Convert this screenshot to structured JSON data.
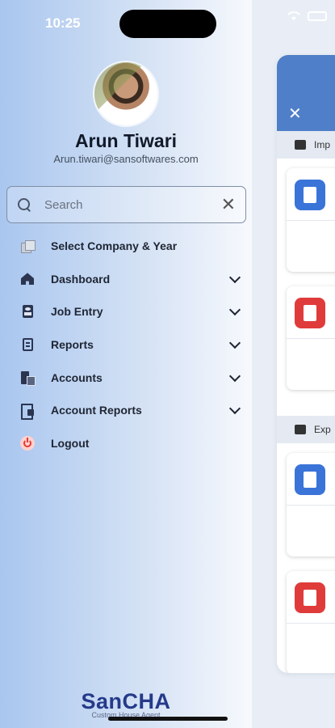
{
  "status_bar": {
    "time": "10:25"
  },
  "user": {
    "name": "Arun Tiwari",
    "email": "Arun.tiwari@sansoftwares.com"
  },
  "search": {
    "placeholder": "Search",
    "value": ""
  },
  "menu": [
    {
      "label": "Select Company & Year",
      "icon": "company-icon",
      "expandable": false
    },
    {
      "label": "Dashboard",
      "icon": "home-icon",
      "expandable": true
    },
    {
      "label": "Job Entry",
      "icon": "job-entry-icon",
      "expandable": true
    },
    {
      "label": "Reports",
      "icon": "reports-icon",
      "expandable": true
    },
    {
      "label": "Accounts",
      "icon": "accounts-icon",
      "expandable": true
    },
    {
      "label": "Account Reports",
      "icon": "account-reports-icon",
      "expandable": true
    },
    {
      "label": "Logout",
      "icon": "logout-icon",
      "expandable": false
    }
  ],
  "brand": {
    "logo_text": "SanCHA",
    "tagline": "Custom House Agent"
  },
  "background_app": {
    "section_1": "Imp",
    "section_2": "Exp",
    "close_icon": "close-icon"
  },
  "colors": {
    "header_blue": "#4f7fc8",
    "doc_blue": "#3b74d8",
    "doc_red": "#e03b3b",
    "logout_red": "#e53935"
  }
}
